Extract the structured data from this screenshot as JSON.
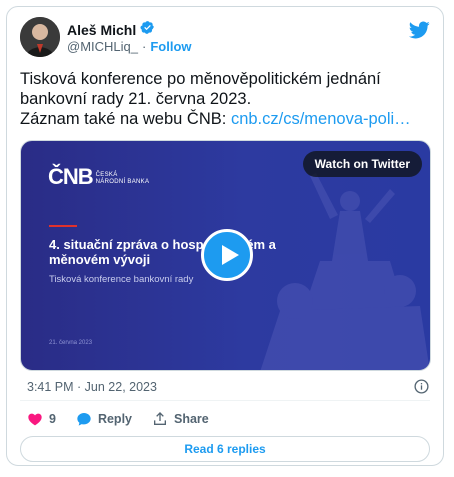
{
  "author": {
    "name": "Aleš Michl",
    "handle": "@MICHLiq_",
    "separator": "·",
    "follow_label": "Follow",
    "verified_icon": "verified-badge-icon"
  },
  "tweet": {
    "text_line1": "Tisková konference po měnověpolitickém jednání",
    "text_line2": "bankovní rady 21. června 2023.",
    "text_line3_prefix": "Záznam také na webu ČNB: ",
    "link_text": "cnb.cz/cs/menova-poli…"
  },
  "media": {
    "watch_label": "Watch on Twitter",
    "logo_main": "ČNB",
    "logo_sub_line1": "ČESKÁ",
    "logo_sub_line2": "NÁRODNÍ BANKA",
    "slide_title": "4. situační zpráva o hospodářském a měnovém vývoji",
    "slide_subtitle": "Tisková konference bankovní rady",
    "slide_date": "21. června 2023"
  },
  "meta": {
    "timestamp": "3:41 PM · Jun 22, 2023"
  },
  "actions": {
    "like_count": "9",
    "reply_label": "Reply",
    "share_label": "Share"
  },
  "footer": {
    "read_replies_label": "Read 6 replies"
  },
  "colors": {
    "accent": "#1d9bf0",
    "like": "#f91880",
    "media_bg": "#2d3aa0",
    "red_line": "#e0312c"
  }
}
